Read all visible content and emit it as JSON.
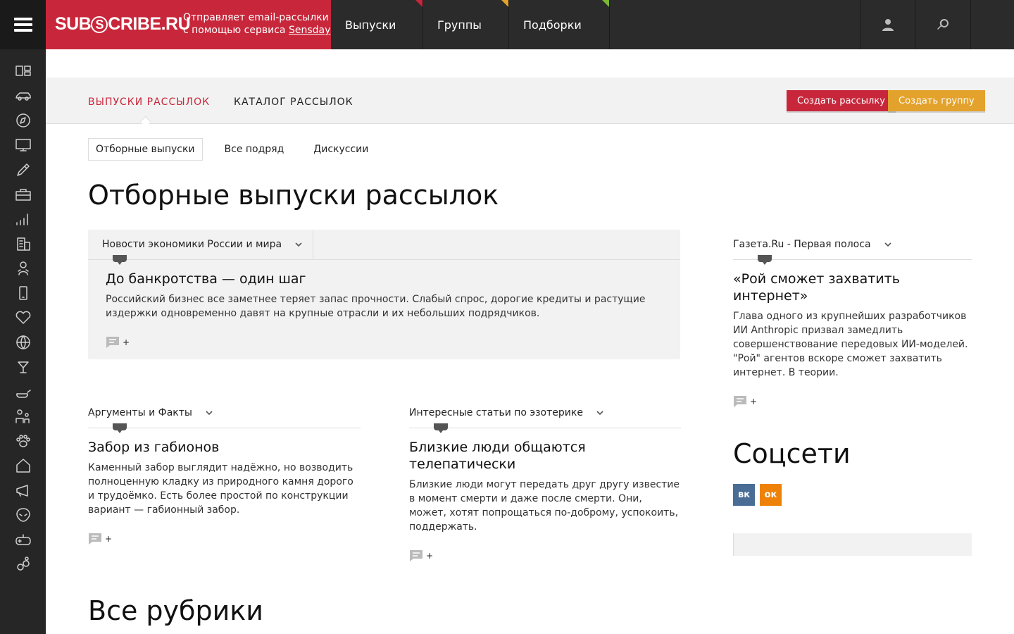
{
  "brand": {
    "logo_left": "SUB",
    "logo_s": "S",
    "logo_right": "CRIBE.RU",
    "tagline_line1": "Отправляет email-рассылки",
    "tagline_line2_prefix": "с помощью сервиса ",
    "tagline_link": "Sensday",
    "color": "#c8273b"
  },
  "topnav": [
    {
      "label": "Выпуски",
      "accent": "#c8273b"
    },
    {
      "label": "Группы",
      "accent": "#e3a22b"
    },
    {
      "label": "Подборки",
      "accent": "#7bb731"
    }
  ],
  "top_icons": [
    "user-icon",
    "search-icon"
  ],
  "sidebar_icons": [
    "grid-icon",
    "car-icon",
    "compass-icon",
    "monitor-icon",
    "pen-icon",
    "briefcase-icon",
    "bar-chart-icon",
    "building-icon",
    "baby-icon",
    "phone-icon",
    "heart-icon",
    "ball-icon",
    "cocktail-icon",
    "cooking-icon",
    "family-icon",
    "paw-icon",
    "home-icon",
    "megaphone-icon",
    "alien-icon",
    "gamepad-icon",
    "hexagons-icon"
  ],
  "subhead": {
    "tab_active": "ВЫПУСКИ РАССЫЛОК",
    "tab_second": "КАТАЛОГ РАССЫЛОК",
    "create_mailing": "Создать рассылку",
    "create_group": "Создать группу"
  },
  "pills": [
    "Отборные выпуски",
    "Все подряд",
    "Дискуссии"
  ],
  "page_title": "Отборные выпуски рассылок",
  "cards": {
    "main": {
      "source": "Новости экономики России и мира",
      "title": "До банкротства — один шаг",
      "text": "Российский бизнес все заметнее теряет запас прочности. Слабый спрос, дорогие кредиты и растущие издержки одновременно давят на крупные отрасли и их небольших подрядчиков.",
      "comments": "+"
    },
    "right": {
      "source": "Газета.Ru - Первая полоса",
      "title": "«Рой сможет захватить интернет»",
      "text": "Глава одного из крупнейших разработчиков ИИ Anthropic призвал замедлить совершенствование передовых ИИ-моделей. \"Рой\" агентов вскоре сможет захватить интернет. В теории.",
      "comments": "+"
    },
    "left2": {
      "source": "Аргументы и Факты",
      "title": "Забор из габионов",
      "text": "Каменный забор выглядит надёжно, но возводить полноценную кладку из природного камня дорого и трудоёмко. Есть более простой по конструкции вариант — габионный забор.",
      "comments": "+"
    },
    "mid2": {
      "source": "Интересные статьи по эзотерике",
      "title": "Близкие люди общаются телепатически",
      "text": "Близкие люди могут передать друг другу известие в момент смерти и даже после смерти. Они, может, хотят попрощаться по-доброму, успокоить, поддержать.",
      "comments": "+"
    }
  },
  "social": {
    "title": "Соцсети",
    "vk": "вк",
    "ok": "ок"
  },
  "rubrics_title": "Все рубрики"
}
